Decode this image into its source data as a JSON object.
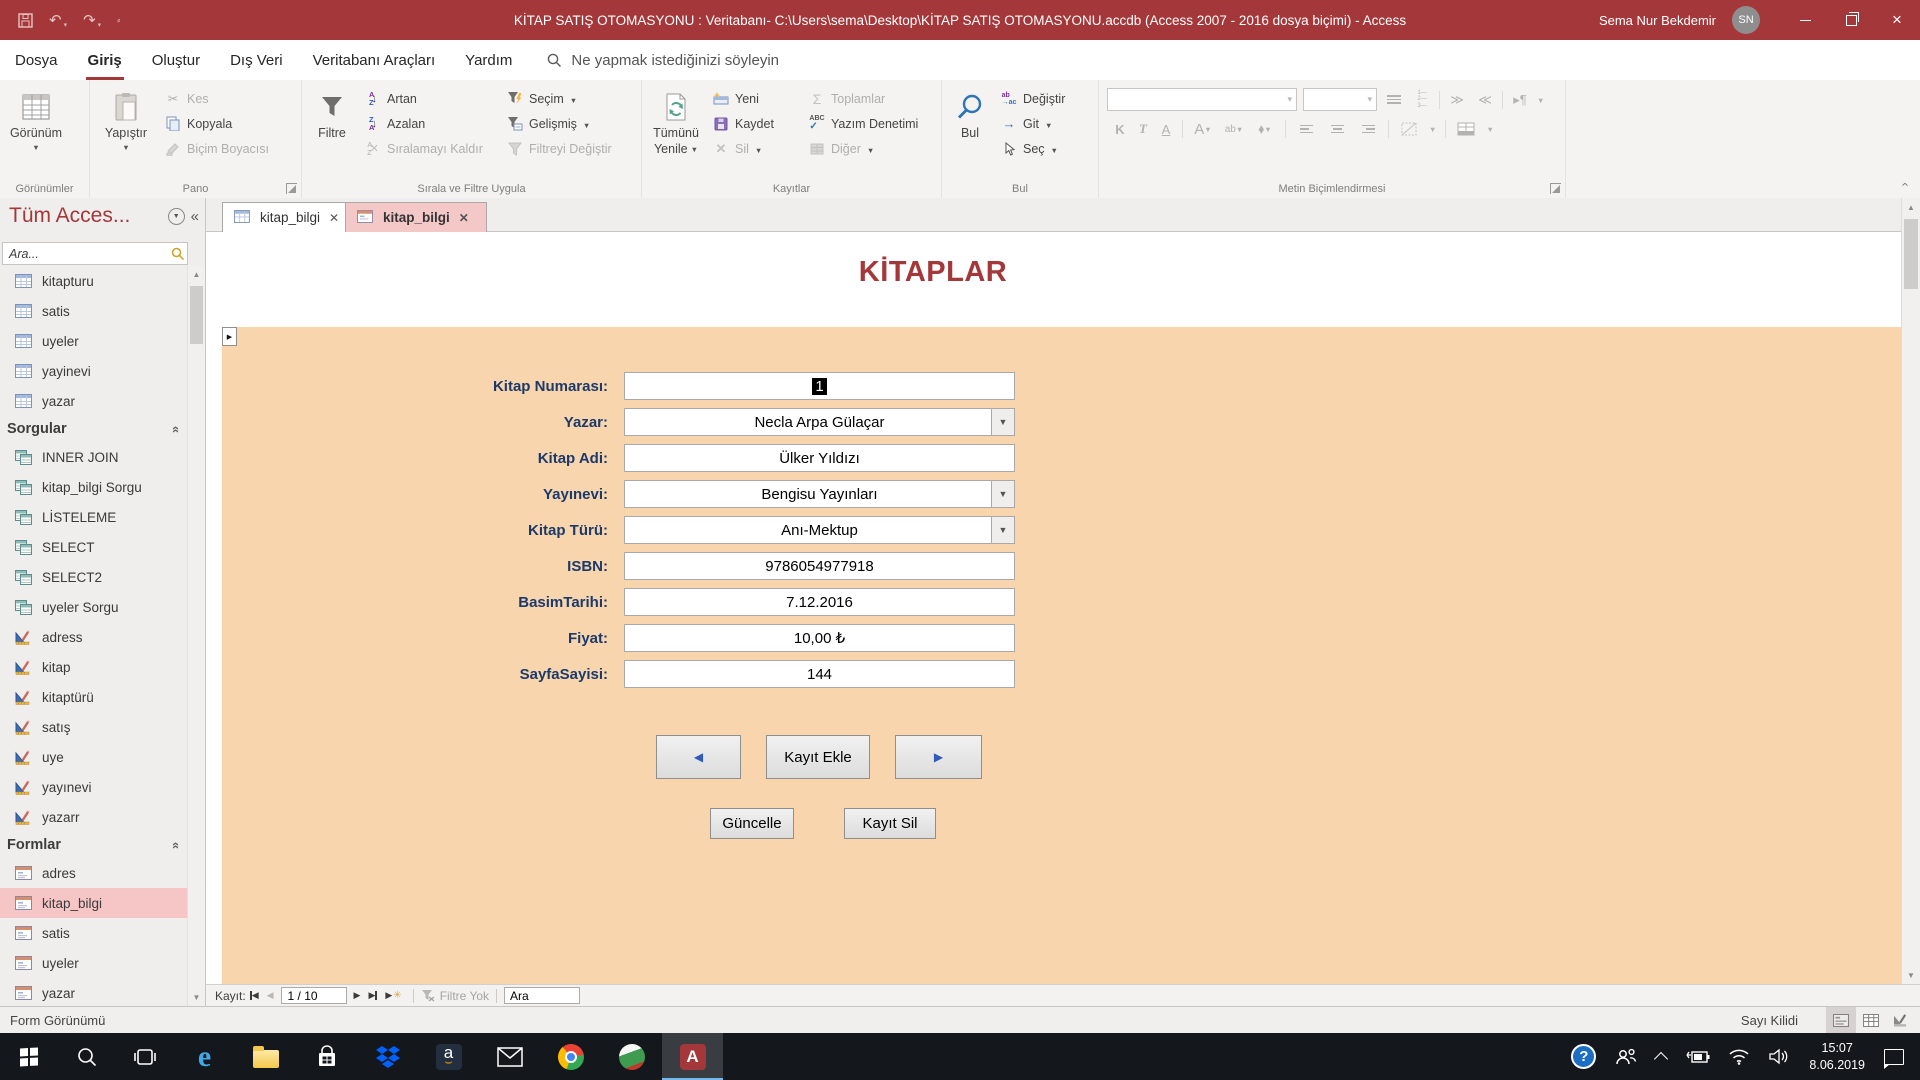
{
  "titlebar": {
    "title": "KİTAP SATIŞ OTOMASYONU : Veritabanı- C:\\Users\\sema\\Desktop\\KİTAP SATIŞ OTOMASYONU.accdb (Access 2007 - 2016 dosya biçimi)  -  Access",
    "user": "Sema Nur Bekdemir",
    "user_initials": "SN"
  },
  "menubar": {
    "tabs": [
      "Dosya",
      "Giriş",
      "Oluştur",
      "Dış Veri",
      "Veritabanı Araçları",
      "Yardım"
    ],
    "active_tab": "Giriş",
    "search_placeholder": "Ne yapmak istediğinizi söyleyin"
  },
  "ribbon": {
    "groups": {
      "views": "Görünümler",
      "clipboard": "Pano",
      "sort": "Sırala ve Filtre Uygula",
      "records": "Kayıtlar",
      "find": "Bul",
      "text": "Metin Biçimlendirmesi"
    },
    "view": "Görünüm",
    "paste": "Yapıştır",
    "cut": "Kes",
    "copy": "Kopyala",
    "format_painter": "Biçim Boyacısı",
    "filter": "Filtre",
    "ascending": "Artan",
    "descending": "Azalan",
    "remove_sort": "Sıralamayı Kaldır",
    "selection": "Seçim",
    "advanced": "Gelişmiş",
    "toggle_filter": "Filtreyi Değiştir",
    "refresh_line1": "Tümünü",
    "refresh_line2": "Yenile",
    "new": "Yeni",
    "save": "Kaydet",
    "delete": "Sil",
    "totals": "Toplamlar",
    "spelling": "Yazım Denetimi",
    "more": "Diğer",
    "find": "Bul",
    "replace": "Değiştir",
    "goto": "Git",
    "select": "Seç"
  },
  "sidebar": {
    "title": "Tüm Acces...",
    "search_placeholder": "Ara...",
    "tables": [
      {
        "label": "kitapturu"
      },
      {
        "label": "satis"
      },
      {
        "label": "uyeler"
      },
      {
        "label": "yayinevi"
      },
      {
        "label": "yazar"
      }
    ],
    "queries_header": "Sorgular",
    "queries": [
      {
        "label": "INNER JOIN"
      },
      {
        "label": "kitap_bilgi Sorgu"
      },
      {
        "label": "LİSTELEME"
      },
      {
        "label": "SELECT"
      },
      {
        "label": "SELECT2"
      },
      {
        "label": "uyeler Sorgu"
      }
    ],
    "designs": [
      {
        "label": "adress"
      },
      {
        "label": "kitap"
      },
      {
        "label": "kitaptürü"
      },
      {
        "label": "satış"
      },
      {
        "label": "uye"
      },
      {
        "label": "yayınevi"
      },
      {
        "label": "yazarr"
      }
    ],
    "forms_header": "Formlar",
    "forms": [
      {
        "label": "adres"
      },
      {
        "label": "kitap_bilgi",
        "selected": true
      },
      {
        "label": "satis"
      },
      {
        "label": "uyeler"
      },
      {
        "label": "yazar"
      }
    ]
  },
  "doc_tabs": [
    {
      "label": "kitap_bilgi"
    },
    {
      "label": "kitap_bilgi"
    }
  ],
  "form": {
    "title": "KİTAPLAR",
    "fields": [
      {
        "label": "Kitap Numarası:",
        "value": "1",
        "type": "text",
        "selected": true
      },
      {
        "label": "Yazar:",
        "value": "Necla Arpa Gülaçar",
        "type": "combo"
      },
      {
        "label": "Kitap Adi:",
        "value": "Ülker Yıldızı",
        "type": "text"
      },
      {
        "label": "Yayınevi:",
        "value": "Bengisu Yayınları",
        "type": "combo"
      },
      {
        "label": "Kitap Türü:",
        "value": "Anı-Mektup",
        "type": "combo"
      },
      {
        "label": "ISBN:",
        "value": "9786054977918",
        "type": "text"
      },
      {
        "label": "BasimTarihi:",
        "value": "7.12.2016",
        "type": "text"
      },
      {
        "label": "Fiyat:",
        "value": "10,00 ₺",
        "type": "text"
      },
      {
        "label": "SayfaSayisi:",
        "value": "144",
        "type": "text"
      }
    ],
    "buttons": {
      "add": "Kayıt Ekle",
      "update": "Güncelle",
      "delete": "Kayıt Sil"
    }
  },
  "recordbar": {
    "label": "Kayıt:",
    "position": "1 / 10",
    "filter_status": "Filtre Yok",
    "search_text": "Ara"
  },
  "statusbar": {
    "view_name": "Form Görünümü",
    "numlock": "Sayı Kilidi"
  },
  "taskbar": {
    "clock_time": "15:07",
    "clock_date": "8.06.2019"
  },
  "colors": {
    "accent_red": "#A4373A",
    "form_background": "#F9D5AD",
    "selection_pink": "#F6C6C6",
    "label_navy": "#1B3A6B"
  }
}
